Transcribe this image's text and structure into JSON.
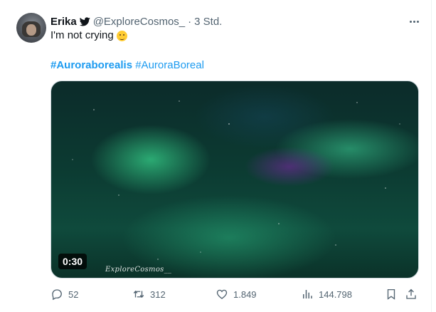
{
  "author": {
    "name": "Erika",
    "handle": "@ExploreCosmos_",
    "separator": "·",
    "time": "3 Std."
  },
  "tweet": {
    "text": "I'm not crying",
    "hashtags": [
      {
        "label": "#Auroraborealis",
        "bold": true
      },
      {
        "label": "#AuroraBoreal",
        "bold": false
      }
    ]
  },
  "media": {
    "duration": "0:30",
    "watermark": "ExploreCosmos__"
  },
  "actions": {
    "replies": "52",
    "retweets": "312",
    "likes": "1.849",
    "views": "144.798"
  },
  "icons": {
    "verified_badge": "bird-icon",
    "more": "more-icon",
    "reply": "reply-icon",
    "retweet": "retweet-icon",
    "like": "heart-icon",
    "views": "views-icon",
    "bookmark": "bookmark-icon",
    "share": "share-icon"
  },
  "colors": {
    "link": "#1d9bf0",
    "secondary_text": "#536471",
    "primary_text": "#0f1419"
  }
}
